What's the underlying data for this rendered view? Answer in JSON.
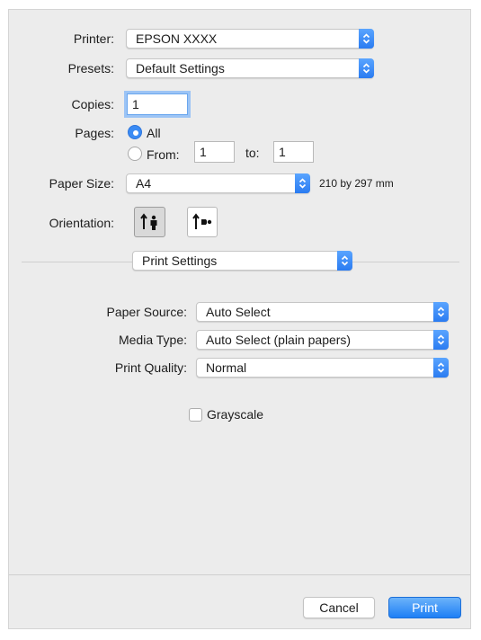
{
  "printer": {
    "label": "Printer:",
    "value": "EPSON XXXX"
  },
  "presets": {
    "label": "Presets:",
    "value": "Default Settings"
  },
  "copies": {
    "label": "Copies:",
    "value": "1"
  },
  "pages": {
    "label": "Pages:",
    "all_label": "All",
    "from_label": "From:",
    "from_value": "1",
    "to_label": "to:",
    "to_value": "1"
  },
  "paper_size": {
    "label": "Paper Size:",
    "value": "A4",
    "dimensions": "210 by 297 mm"
  },
  "orientation": {
    "label": "Orientation:",
    "selected": "portrait"
  },
  "panel_menu": {
    "value": "Print Settings"
  },
  "paper_source": {
    "label": "Paper Source:",
    "value": "Auto Select"
  },
  "media_type": {
    "label": "Media Type:",
    "value": "Auto Select (plain papers)"
  },
  "print_quality": {
    "label": "Print Quality:",
    "value": "Normal"
  },
  "grayscale": {
    "label": "Grayscale",
    "checked": false
  },
  "buttons": {
    "cancel": "Cancel",
    "print": "Print"
  },
  "colors": {
    "accent": "#2a7bf1",
    "dialog_bg": "#ececec"
  }
}
